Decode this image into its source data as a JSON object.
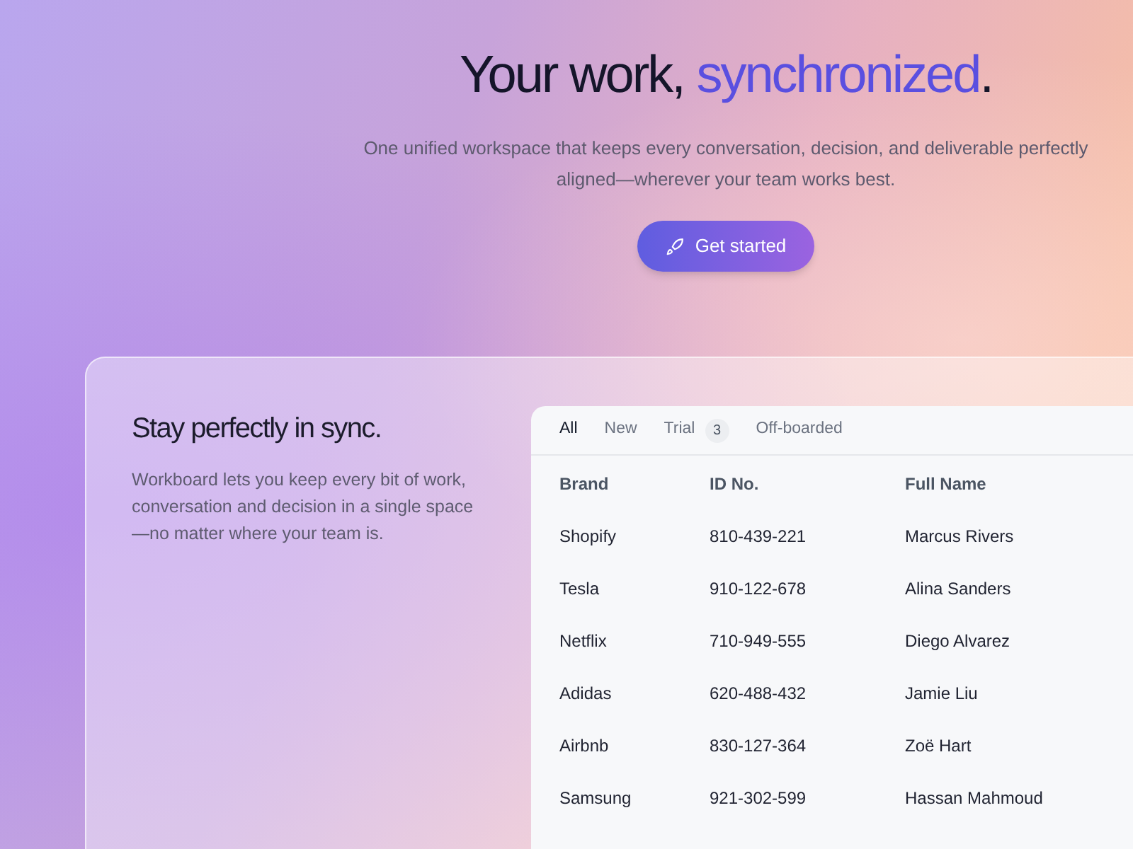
{
  "hero": {
    "title": [
      {
        "text": "Your work, ",
        "accent": false
      },
      {
        "text": "synchronized",
        "accent": true
      },
      {
        "text": ".",
        "accent": false
      }
    ],
    "subtitle": "One unified workspace that keeps every conversation, decision, and deliverable perfectly aligned—wherever your team works best.",
    "button": "Get started"
  },
  "feature": {
    "heading": "Stay perfectly in sync.",
    "body": "Workboard lets you keep every bit of work, conversation and decision in a single space—no matter where your team is."
  },
  "tabs": [
    {
      "label": "All",
      "selected": true
    },
    {
      "label": "New",
      "selected": false
    },
    {
      "label": "Trial",
      "selected": false,
      "count": "3"
    },
    {
      "label": "Off-boarded",
      "selected": false
    }
  ],
  "table": {
    "columns": [
      "Brand",
      "ID No.",
      "Full Name"
    ],
    "rows": [
      [
        "Shopify",
        "810-439-221",
        "Marcus Rivers"
      ],
      [
        "Tesla",
        "910-122-678",
        "Alina Sanders"
      ],
      [
        "Netflix",
        "710-949-555",
        "Diego Alvarez"
      ],
      [
        "Adidas",
        "620-488-432",
        "Jamie Liu"
      ],
      [
        "Airbnb",
        "830-127-364",
        "Zoë Hart"
      ],
      [
        "Samsung",
        "921-302-599",
        "Hassan Mahmoud"
      ]
    ]
  }
}
